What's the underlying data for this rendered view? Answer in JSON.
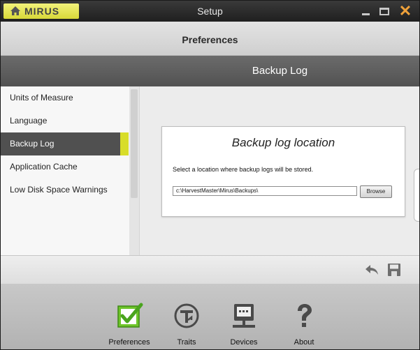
{
  "app": {
    "logo_text": "MIRUS",
    "window_title": "Setup",
    "close_glyph": "✕",
    "accent_color": "#d8dd2a"
  },
  "header": {
    "title": "Preferences"
  },
  "section": {
    "title": "Backup Log"
  },
  "sidebar": {
    "items": [
      {
        "label": "Units of Measure",
        "selected": false
      },
      {
        "label": "Language",
        "selected": false
      },
      {
        "label": "Backup Log",
        "selected": true
      },
      {
        "label": "Application Cache",
        "selected": false
      },
      {
        "label": "Low Disk Space Warnings",
        "selected": false
      }
    ]
  },
  "backup": {
    "card_title": "Backup log location",
    "description": "Select a location where backup logs will be stored.",
    "path_value": "c:\\HarvestMaster\\Mirus\\Backups\\",
    "browse_label": "Browse"
  },
  "actions": {
    "undo_icon": "undo-icon",
    "save_icon": "save-icon"
  },
  "nav": {
    "items": [
      {
        "label": "Preferences",
        "icon": "preferences-check-icon",
        "active": true
      },
      {
        "label": "Traits",
        "icon": "traits-icon",
        "active": false
      },
      {
        "label": "Devices",
        "icon": "devices-icon",
        "active": false
      },
      {
        "label": "About",
        "icon": "question-icon",
        "active": false
      }
    ]
  }
}
